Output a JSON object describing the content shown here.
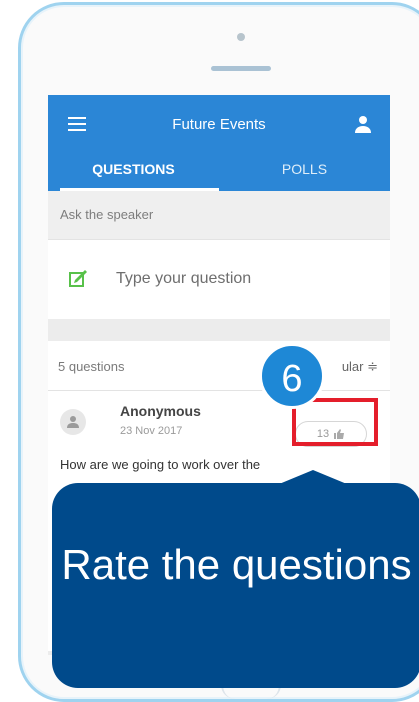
{
  "app": {
    "title": "Future Events"
  },
  "tabs": [
    {
      "label": "QUESTIONS",
      "active": true
    },
    {
      "label": "POLLS",
      "active": false
    }
  ],
  "ask": {
    "section_label": "Ask the speaker",
    "placeholder": "Type your question"
  },
  "list": {
    "count_label": "5 questions",
    "sort_label": "ular ≑"
  },
  "question": {
    "author": "Anonymous",
    "date": "23 Nov 2017",
    "text": "How are we going to work over the",
    "votes": "13"
  },
  "tutorial": {
    "step": "6",
    "caption": "Rate the questions"
  },
  "colors": {
    "primary": "#2b86d6",
    "callout": "#004a8b",
    "highlight": "#e41e2b",
    "edit_icon": "#58c14a"
  },
  "icons": {
    "menu": "menu-icon",
    "user": "user-icon",
    "edit": "edit-icon",
    "thumb": "thumbs-up-icon",
    "avatar": "person-icon"
  }
}
